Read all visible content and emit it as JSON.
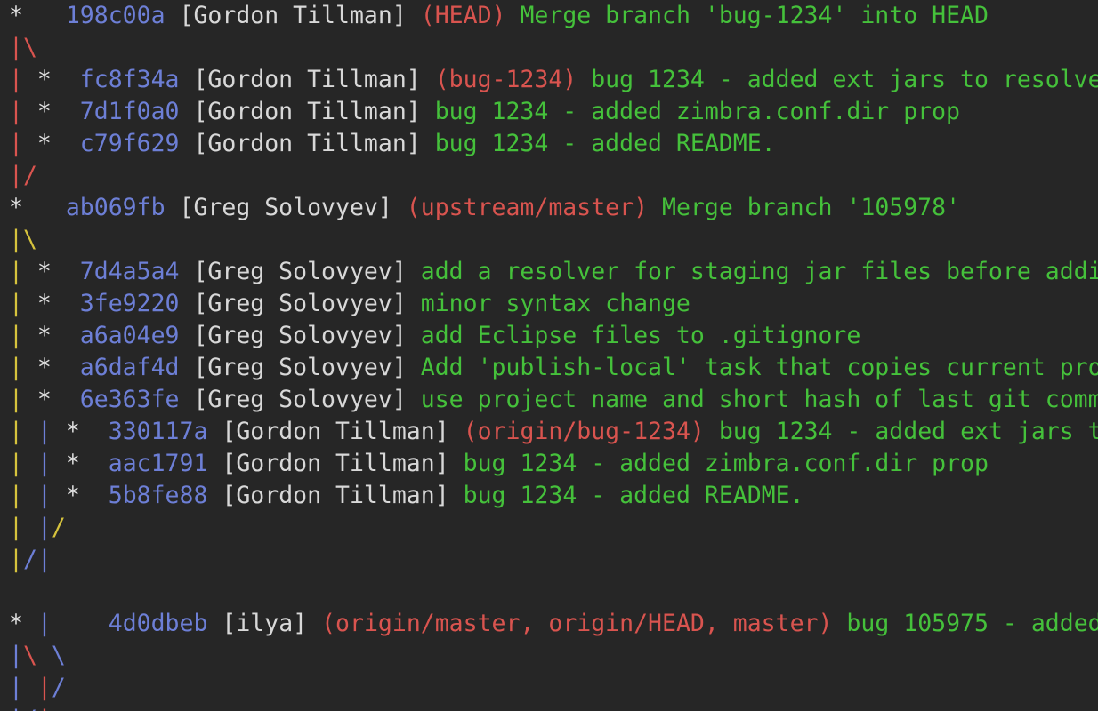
{
  "colors": {
    "background": "#262626",
    "hash": "#6d7fd6",
    "author": "#d8d8d8",
    "ref": "#d9544f",
    "message": "#45c13b",
    "graph_red": "#d9544f",
    "graph_yellow": "#d6c33d",
    "graph_blue": "#6d7fd6"
  },
  "rows": [
    {
      "graph": [
        [
          "*",
          "white"
        ],
        [
          "   ",
          "white"
        ]
      ],
      "hash": "198c00a",
      "author": "[Gordon Tillman]",
      "ref": "(HEAD)",
      "message": "Merge branch 'bug-1234' into HEAD"
    },
    {
      "graph": [
        [
          "|\\",
          "red"
        ]
      ]
    },
    {
      "graph": [
        [
          "|",
          "red"
        ],
        [
          " *  ",
          "white"
        ]
      ],
      "hash": "fc8f34a",
      "author": "[Gordon Tillman]",
      "ref": "(bug-1234)",
      "message": "bug 1234 - added ext jars to resolve"
    },
    {
      "graph": [
        [
          "|",
          "red"
        ],
        [
          " *  ",
          "white"
        ]
      ],
      "hash": "7d1f0a0",
      "author": "[Gordon Tillman]",
      "message": "bug 1234 - added zimbra.conf.dir prop"
    },
    {
      "graph": [
        [
          "|",
          "red"
        ],
        [
          " *  ",
          "white"
        ]
      ],
      "hash": "c79f629",
      "author": "[Gordon Tillman]",
      "message": "bug 1234 - added README."
    },
    {
      "graph": [
        [
          "|/",
          "red"
        ]
      ]
    },
    {
      "graph": [
        [
          "*",
          "white"
        ],
        [
          "   ",
          "white"
        ]
      ],
      "hash": "ab069fb",
      "author": "[Greg Solovyev]",
      "ref": "(upstream/master)",
      "message": "Merge branch '105978'"
    },
    {
      "graph": [
        [
          "|\\",
          "yellow"
        ]
      ]
    },
    {
      "graph": [
        [
          "|",
          "yellow"
        ],
        [
          " *  ",
          "white"
        ]
      ],
      "hash": "7d4a5a4",
      "author": "[Greg Solovyev]",
      "message": "add a resolver for staging jar files before addi"
    },
    {
      "graph": [
        [
          "|",
          "yellow"
        ],
        [
          " *  ",
          "white"
        ]
      ],
      "hash": "3fe9220",
      "author": "[Greg Solovyev]",
      "message": "minor syntax change"
    },
    {
      "graph": [
        [
          "|",
          "yellow"
        ],
        [
          " *  ",
          "white"
        ]
      ],
      "hash": "a6a04e9",
      "author": "[Greg Solovyev]",
      "message": "add Eclipse files to .gitignore"
    },
    {
      "graph": [
        [
          "|",
          "yellow"
        ],
        [
          " *  ",
          "white"
        ]
      ],
      "hash": "a6daf4d",
      "author": "[Greg Solovyev]",
      "message": "Add 'publish-local' task that copies current pro"
    },
    {
      "graph": [
        [
          "|",
          "yellow"
        ],
        [
          " *  ",
          "white"
        ]
      ],
      "hash": "6e363fe",
      "author": "[Greg Solovyev]",
      "message": "use project name and short hash of last git comm"
    },
    {
      "graph": [
        [
          "|",
          "yellow"
        ],
        [
          " ",
          "white"
        ],
        [
          "|",
          "blue"
        ],
        [
          " *  ",
          "white"
        ]
      ],
      "hash": "330117a",
      "author": "[Gordon Tillman]",
      "ref": "(origin/bug-1234)",
      "message": "bug 1234 - added ext jars t"
    },
    {
      "graph": [
        [
          "|",
          "yellow"
        ],
        [
          " ",
          "white"
        ],
        [
          "|",
          "blue"
        ],
        [
          " *  ",
          "white"
        ]
      ],
      "hash": "aac1791",
      "author": "[Gordon Tillman]",
      "message": "bug 1234 - added zimbra.conf.dir prop"
    },
    {
      "graph": [
        [
          "|",
          "yellow"
        ],
        [
          " ",
          "white"
        ],
        [
          "|",
          "blue"
        ],
        [
          " *  ",
          "white"
        ]
      ],
      "hash": "5b8fe88",
      "author": "[Gordon Tillman]",
      "message": "bug 1234 - added README."
    },
    {
      "graph": [
        [
          "|",
          "yellow"
        ],
        [
          " ",
          "white"
        ],
        [
          "|",
          "blue"
        ],
        [
          "/",
          "yellow"
        ]
      ]
    },
    {
      "graph": [
        [
          "|",
          "yellow"
        ],
        [
          "/",
          "blue"
        ],
        [
          "|",
          "blue"
        ]
      ]
    },
    {
      "graph": []
    },
    {
      "graph": [
        [
          "*",
          "white"
        ],
        [
          " ",
          "white"
        ],
        [
          "|",
          "blue"
        ],
        [
          "    ",
          "white"
        ]
      ],
      "hash": "4d0dbeb",
      "author": "[ilya]",
      "ref": "(origin/master, origin/HEAD, master)",
      "message": "bug 105975 - added"
    },
    {
      "graph": [
        [
          "|",
          "blue"
        ],
        [
          "\\",
          "red"
        ],
        [
          " ",
          "white"
        ],
        [
          "\\",
          "blue"
        ]
      ]
    },
    {
      "graph": [
        [
          "|",
          "blue"
        ],
        [
          " ",
          "white"
        ],
        [
          "|",
          "red"
        ],
        [
          "/",
          "blue"
        ]
      ]
    },
    {
      "graph": [
        [
          "|",
          "blue"
        ],
        [
          "/",
          "blue"
        ],
        [
          "|",
          "red"
        ]
      ]
    }
  ]
}
